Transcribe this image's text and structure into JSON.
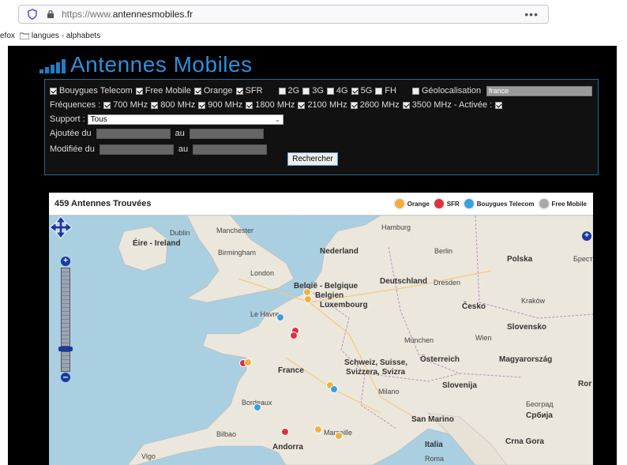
{
  "browser": {
    "url_prefix": "https://www.",
    "url_domain": "antennesmobiles.fr",
    "menu": "•••",
    "bookmarks": [
      "efox",
      "langues - alphabets"
    ]
  },
  "site": {
    "title": "Antennes Mobiles"
  },
  "form": {
    "operators": [
      {
        "label": "Bouygues Telecom",
        "checked": true
      },
      {
        "label": "Free Mobile",
        "checked": true
      },
      {
        "label": "Orange",
        "checked": true
      },
      {
        "label": "SFR",
        "checked": true
      }
    ],
    "technologies": [
      {
        "label": "2G",
        "checked": false
      },
      {
        "label": "3G",
        "checked": false
      },
      {
        "label": "4G",
        "checked": false
      },
      {
        "label": "5G",
        "checked": true
      },
      {
        "label": "FH",
        "checked": false
      }
    ],
    "geoloc_label": "Géolocalisation",
    "geoloc_checked": false,
    "geoloc_value": "france",
    "freq_label": "Fréquences :",
    "frequencies": [
      {
        "label": "700 MHz",
        "checked": true
      },
      {
        "label": "800 MHz",
        "checked": true
      },
      {
        "label": "900 MHz",
        "checked": true
      },
      {
        "label": "1800 MHz",
        "checked": true
      },
      {
        "label": "2100 MHz",
        "checked": true
      },
      {
        "label": "2600 MHz",
        "checked": true
      },
      {
        "label": "3500 MHz - Activée :",
        "checked": true
      }
    ],
    "support_label": "Support :",
    "support_value": "Tous",
    "added_label": "Ajoutée du",
    "modified_label": "Modifiée du",
    "au_label": "au",
    "search_button": "Rechercher"
  },
  "results": {
    "count_text": "459 Antennes Trouvées",
    "legend": [
      {
        "label": "Orange",
        "color": "#f0b040"
      },
      {
        "label": "SFR",
        "color": "#e03040"
      },
      {
        "label": "Bouygues Telecom",
        "color": "#3aa0e0"
      },
      {
        "label": "Free Mobile",
        "color": "#aaaaaa"
      }
    ]
  },
  "map": {
    "places": [
      {
        "name": "Dublin",
        "bold": false
      },
      {
        "name": "Éire - Ireland",
        "bold": true
      },
      {
        "name": "Manchester",
        "bold": false
      },
      {
        "name": "Birmingham",
        "bold": false
      },
      {
        "name": "London",
        "bold": false
      },
      {
        "name": "Hamburg",
        "bold": false
      },
      {
        "name": "Nederland",
        "bold": true
      },
      {
        "name": "Berlin",
        "bold": false
      },
      {
        "name": "Polska",
        "bold": true
      },
      {
        "name": "Брест",
        "bold": false
      },
      {
        "name": "België - Belgique",
        "bold": true
      },
      {
        "name": "Belgien",
        "bold": true
      },
      {
        "name": "Deutschland",
        "bold": true
      },
      {
        "name": "Dresden",
        "bold": false
      },
      {
        "name": "Luxembourg",
        "bold": true
      },
      {
        "name": "Kraków",
        "bold": false
      },
      {
        "name": "Česko",
        "bold": true
      },
      {
        "name": "Le Havre",
        "bold": false
      },
      {
        "name": "Slovensko",
        "bold": true
      },
      {
        "name": "München",
        "bold": false
      },
      {
        "name": "Wien",
        "bold": false
      },
      {
        "name": "Schweiz, Suisse,",
        "bold": true
      },
      {
        "name": "Svizzera, Svizra",
        "bold": true
      },
      {
        "name": "Österreich",
        "bold": true
      },
      {
        "name": "Magyarország",
        "bold": true
      },
      {
        "name": "France",
        "bold": true
      },
      {
        "name": "Milano",
        "bold": false
      },
      {
        "name": "Slovenija",
        "bold": true
      },
      {
        "name": "Ror",
        "bold": true
      },
      {
        "name": "Bordeaux",
        "bold": false
      },
      {
        "name": "Београд",
        "bold": false
      },
      {
        "name": "Србија",
        "bold": true
      },
      {
        "name": "San Marino",
        "bold": true
      },
      {
        "name": "Bilbao",
        "bold": false
      },
      {
        "name": "Marseille",
        "bold": false
      },
      {
        "name": "Andorra",
        "bold": true
      },
      {
        "name": "Italia",
        "bold": true
      },
      {
        "name": "Crna Gora",
        "bold": true
      },
      {
        "name": "Vigo",
        "bold": false
      },
      {
        "name": "Roma",
        "bold": false
      }
    ],
    "markers": [
      {
        "operator": "Orange"
      },
      {
        "operator": "Orange"
      },
      {
        "operator": "Bouygues Telecom"
      },
      {
        "operator": "SFR"
      },
      {
        "operator": "SFR"
      },
      {
        "operator": "SFR"
      },
      {
        "operator": "Orange"
      },
      {
        "operator": "Orange"
      },
      {
        "operator": "Bouygues Telecom"
      },
      {
        "operator": "Bouygues Telecom"
      },
      {
        "operator": "SFR"
      },
      {
        "operator": "Orange"
      },
      {
        "operator": "Orange"
      }
    ]
  }
}
